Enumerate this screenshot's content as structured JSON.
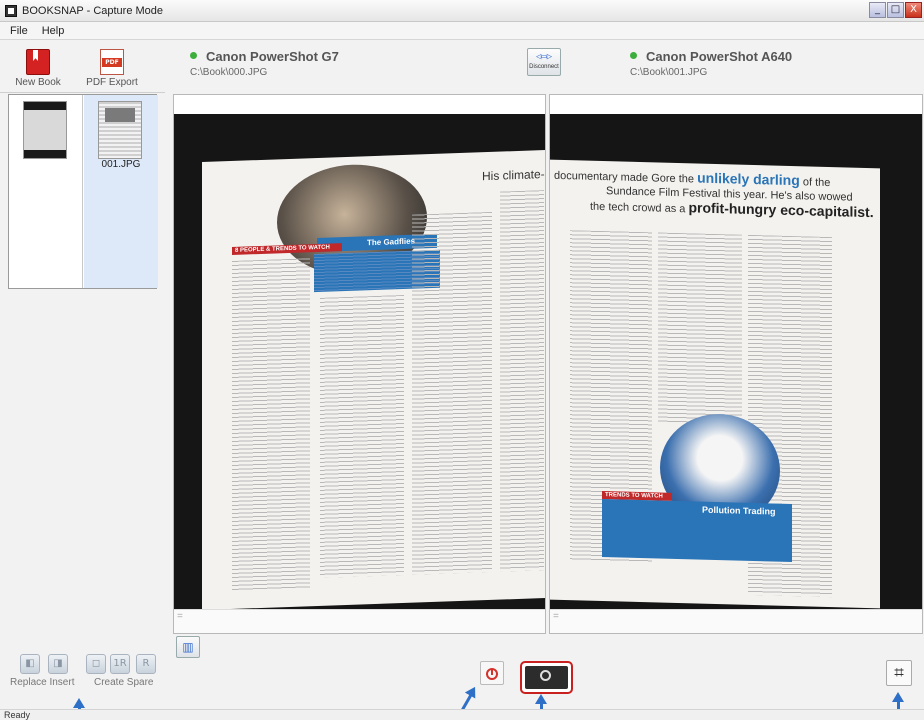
{
  "window": {
    "title": "BOOKSNAP - Capture Mode",
    "controls": {
      "minimize": "_",
      "maximize": "□",
      "close": "X"
    }
  },
  "menu": {
    "items": [
      "File",
      "Help"
    ]
  },
  "toolbar": {
    "new_book": "New Book",
    "pdf_export": "PDF Export",
    "pdf_badge": "PDF"
  },
  "thumbnails": [
    {
      "label": ""
    },
    {
      "label": "001.JPG"
    }
  ],
  "cameras": {
    "left": {
      "name": "Canon PowerShot G7",
      "path": "C:\\Book\\000.JPG"
    },
    "right": {
      "name": "Canon PowerShot A640",
      "path": "C:\\Book\\001.JPG"
    },
    "disconnect_label": "Disconnect",
    "disconnect_icon": "plug-icon"
  },
  "preview_pages": {
    "left_headline": "His climate-cr",
    "left_banner": "8 PEOPLE & TRENDS TO WATCH",
    "left_box_title": "The Gadflies",
    "right_headline_1": "documentary made Gore the",
    "right_headline_1b": "unlikely darling",
    "right_headline_1c": "of the",
    "right_headline_2": "Sundance Film Festival this year. He's also wowed",
    "right_headline_3": "the tech crowd as a",
    "right_headline_3b": "profit-hungry eco-capitalist.",
    "right_banner": "TRENDS TO WATCH",
    "right_box_title": "Pollution Trading"
  },
  "bottom_left": {
    "replace_insert": "Replace Insert",
    "create_spare": "Create Spare",
    "btn_icons": [
      "◧",
      "◨",
      "◻",
      "1R",
      "R"
    ]
  },
  "bottom_center": {
    "grid_icon": "▥",
    "crop_icon": "⌗"
  },
  "footer_markers": {
    "left": "=",
    "right": "="
  },
  "status": {
    "text": "Ready"
  },
  "colors": {
    "accent_blue": "#2e6fc7",
    "capture_red": "#c8211f",
    "connected_green": "#3cae3c"
  }
}
